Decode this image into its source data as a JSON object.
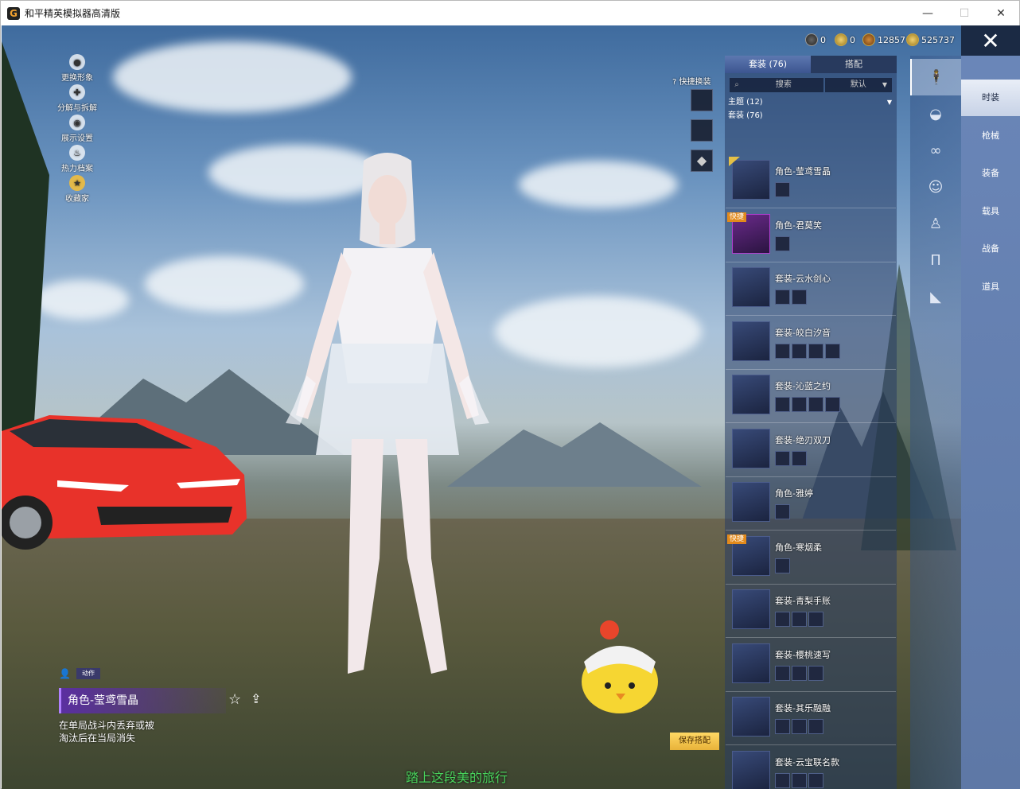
{
  "window": {
    "app_icon": "G",
    "title": "和平精英模拟器高清版",
    "minimize": "—",
    "maximize": "☐",
    "close": "✕"
  },
  "left_menu": [
    {
      "label": "更换形象",
      "icon": "person-icon"
    },
    {
      "label": "分解与拆解",
      "icon": "puzzle-icon"
    },
    {
      "label": "展示设置",
      "icon": "eye-icon"
    },
    {
      "label": "热力档案",
      "icon": "flame-icon"
    },
    {
      "label": "收藏家",
      "icon": "medal-icon"
    }
  ],
  "currency": [
    {
      "value": "0"
    },
    {
      "value": "0"
    },
    {
      "value": "12857"
    },
    {
      "value": "525737"
    }
  ],
  "quick_change_label": "快捷换装",
  "panel": {
    "tabs": [
      "套装 (76)",
      "搭配"
    ],
    "search_placeholder": "搜索",
    "sort_label": "默认",
    "theme_label": "主题 (12)",
    "suit_label": "套装 (76)"
  },
  "fast_badge": "快捷",
  "items": [
    {
      "name": "角色-莹鸢雪晶",
      "subs": 1,
      "frame": "normal",
      "badge": "check"
    },
    {
      "name": "角色-君莫笑",
      "subs": 1,
      "frame": "purple",
      "badge": "fast"
    },
    {
      "name": "套装-云水剑心",
      "subs": 2,
      "frame": "normal",
      "badge": ""
    },
    {
      "name": "套装-皎白汐音",
      "subs": 4,
      "frame": "normal",
      "badge": ""
    },
    {
      "name": "套装-沁蓝之约",
      "subs": 4,
      "frame": "normal",
      "badge": ""
    },
    {
      "name": "套装-绝刃双刀",
      "subs": 2,
      "frame": "normal",
      "badge": ""
    },
    {
      "name": "角色-雅婷",
      "subs": 1,
      "frame": "normal",
      "badge": ""
    },
    {
      "name": "角色-寒烟柔",
      "subs": 1,
      "frame": "normal",
      "badge": "fast"
    },
    {
      "name": "套装-青梨手账",
      "subs": 3,
      "frame": "normal",
      "badge": ""
    },
    {
      "name": "套装-樱桃速写",
      "subs": 3,
      "frame": "normal",
      "badge": ""
    },
    {
      "name": "套装-其乐融融",
      "subs": 3,
      "frame": "normal",
      "badge": ""
    },
    {
      "name": "套装-云宝联名款",
      "subs": 3,
      "frame": "normal",
      "badge": ""
    }
  ],
  "categories": [
    {
      "icon": "figure-icon",
      "glyph": "🕴"
    },
    {
      "icon": "cap-icon",
      "glyph": "◒"
    },
    {
      "icon": "glasses-icon",
      "glyph": "∞"
    },
    {
      "icon": "face-icon",
      "glyph": "☺"
    },
    {
      "icon": "body-icon",
      "glyph": "♙"
    },
    {
      "icon": "pants-icon",
      "glyph": "Π"
    },
    {
      "icon": "shoes-icon",
      "glyph": "◣"
    }
  ],
  "side_menu": [
    "时装",
    "枪械",
    "装备",
    "载具",
    "战备",
    "道具"
  ],
  "selected": {
    "action_chip": "动作",
    "name": "角色-莹鸢雪晶",
    "desc_line1": "在单局战斗内丢弃或被",
    "desc_line2": "淘汰后在当局消失"
  },
  "save_button": "保存搭配",
  "bottom_text": "踏上这段美的旅行"
}
